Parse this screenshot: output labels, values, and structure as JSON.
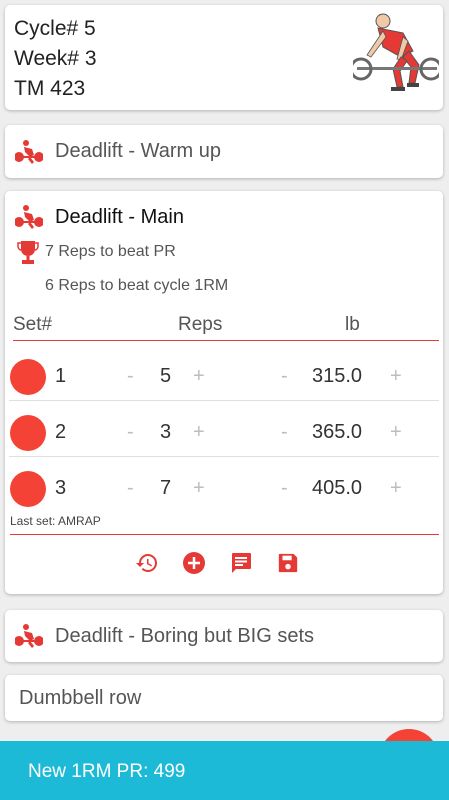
{
  "header": {
    "cycle": "Cycle# 5",
    "week": "Week# 3",
    "tm": "TM 423"
  },
  "exercises": {
    "warmup_title": "Deadlift - Warm up",
    "main_title": "Deadlift - Main",
    "bbb_title": "Deadlift - Boring but BIG sets",
    "row_title": "Dumbbell row"
  },
  "main": {
    "pr_text": "7 Reps to beat PR",
    "cycle_text": "6 Reps to beat cycle 1RM",
    "columns": {
      "set": "Set#",
      "reps": "Reps",
      "weight": "lb"
    },
    "sets": [
      {
        "num": "1",
        "reps": "5",
        "weight": "315.0"
      },
      {
        "num": "2",
        "reps": "3",
        "weight": "365.0"
      },
      {
        "num": "3",
        "reps": "7",
        "weight": "405.0"
      }
    ],
    "stepper_minus": "-",
    "stepper_plus": "+",
    "last_set": "Last set: AMRAP"
  },
  "icons": {
    "history": "history-icon",
    "add": "add-circle-icon",
    "comment": "comment-icon",
    "save": "save-icon",
    "trophy": "trophy-icon",
    "lifter": "deadlift-figure-icon"
  },
  "snackbar": {
    "text": "New 1RM PR: 499"
  },
  "colors": {
    "accent": "#f44336",
    "snackbar": "#1cbad6",
    "divider": "#e53935"
  }
}
